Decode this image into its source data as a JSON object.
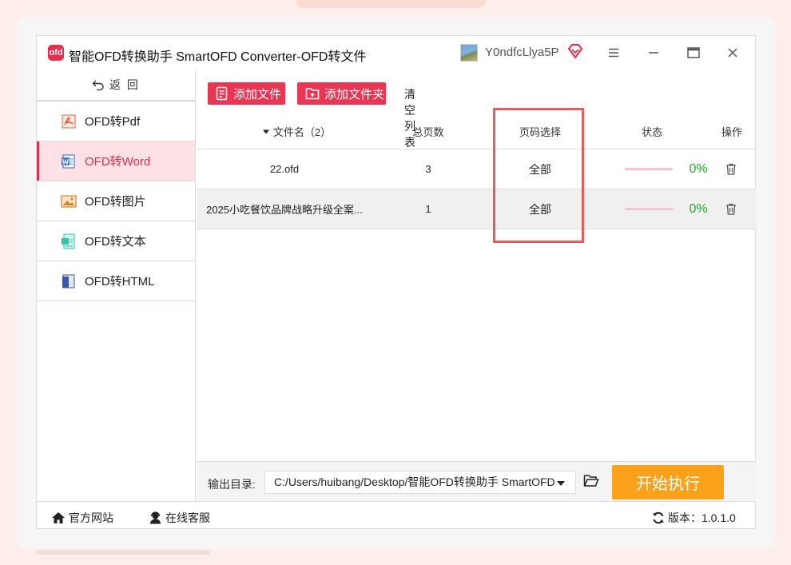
{
  "window": {
    "title": "智能OFD转换助手 SmartOFD Converter-OFD转文件",
    "logo_text": "ofd",
    "username": "Y0ndfcLlya5P"
  },
  "sidebar": {
    "back_label": "返 回",
    "items": [
      {
        "label": "OFD转Pdf",
        "icon": "pdf-icon",
        "active": false
      },
      {
        "label": "OFD转Word",
        "icon": "word-icon",
        "active": true
      },
      {
        "label": "OFD转图片",
        "icon": "image-icon",
        "active": false
      },
      {
        "label": "OFD转文本",
        "icon": "text-icon",
        "active": false
      },
      {
        "label": "OFD转HTML",
        "icon": "html-icon",
        "active": false
      }
    ]
  },
  "toolbar": {
    "add_file_label": "添加文件",
    "add_folder_label": "添加文件夹",
    "clear_list_label": "清空列表"
  },
  "table": {
    "headers": {
      "filename": "文件名（2）",
      "pages": "总页数",
      "page_select": "页码选择",
      "status": "状态",
      "action": "操作"
    },
    "rows": [
      {
        "filename": "22.ofd",
        "pages": "3",
        "page_select": "全部",
        "progress": 0,
        "percent": "0%"
      },
      {
        "filename": "2025小吃餐饮品牌战略升级全案...",
        "pages": "1",
        "page_select": "全部",
        "progress": 0,
        "percent": "0%"
      }
    ]
  },
  "output": {
    "label": "输出目录:",
    "path": "C:/Users/huibang/Desktop/智能OFD转换助手 SmartOFD",
    "start_label": "开始执行"
  },
  "statusbar": {
    "website_label": "官方网站",
    "service_label": "在线客服",
    "version_label": "版本：1.0.1.0"
  },
  "colors": {
    "accent": "#ea3553",
    "start": "#fba21a",
    "progress_text": "#25a52a",
    "highlight_box": "#f0595a"
  }
}
